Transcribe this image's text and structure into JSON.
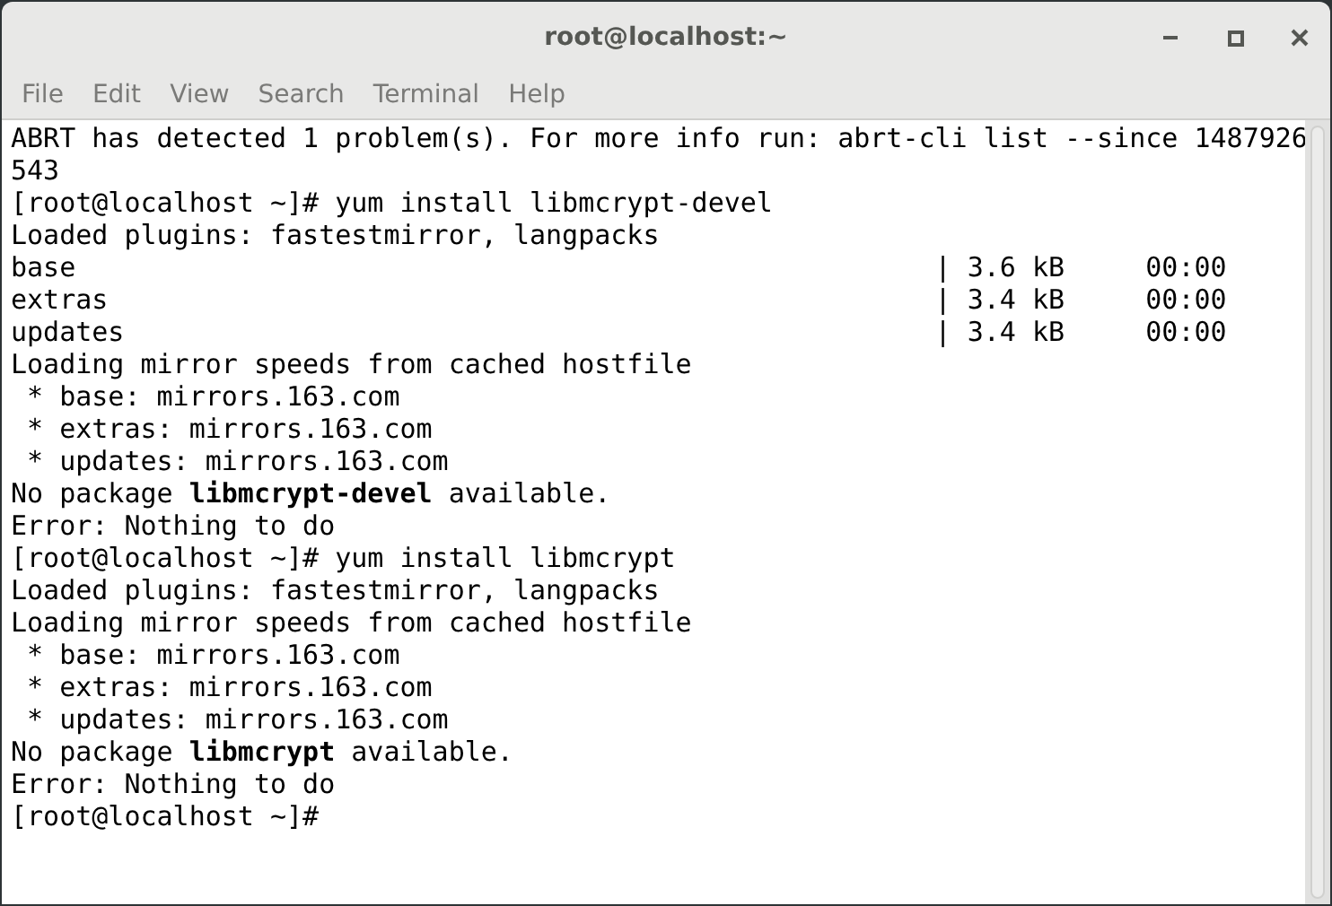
{
  "window": {
    "title": "root@localhost:~"
  },
  "menu": [
    "File",
    "Edit",
    "View",
    "Search",
    "Terminal",
    "Help"
  ],
  "terminal": {
    "lines": [
      "ABRT has detected 1 problem(s). For more info run: abrt-cli list --since 1487926",
      "543",
      "[root@localhost ~]# yum install libmcrypt-devel",
      "Loaded plugins: fastestmirror, langpacks",
      "base                                                     | 3.6 kB     00:00",
      "extras                                                   | 3.4 kB     00:00",
      "updates                                                  | 3.4 kB     00:00",
      "Loading mirror speeds from cached hostfile",
      " * base: mirrors.163.com",
      " * extras: mirrors.163.com",
      " * updates: mirrors.163.com",
      "No package **libmcrypt-devel** available.",
      "Error: Nothing to do",
      "[root@localhost ~]# yum install libmcrypt",
      "Loaded plugins: fastestmirror, langpacks",
      "Loading mirror speeds from cached hostfile",
      " * base: mirrors.163.com",
      " * extras: mirrors.163.com",
      " * updates: mirrors.163.com",
      "No package **libmcrypt** available.",
      "Error: Nothing to do",
      "[root@localhost ~]#"
    ]
  }
}
